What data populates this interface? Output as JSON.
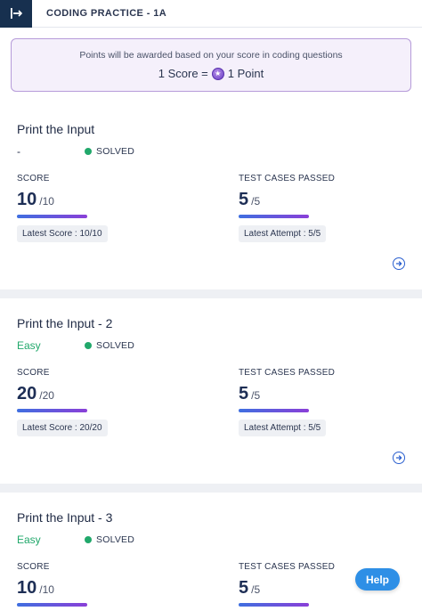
{
  "header": {
    "title": "CODING PRACTICE - 1A"
  },
  "banner": {
    "message": "Points will be awarded based on your score in coding questions",
    "equation_left": "1 Score =",
    "equation_right": "1 Point"
  },
  "questions": [
    {
      "title": "Print the Input",
      "difficulty": "-",
      "difficulty_color": "#1f2a44",
      "status": "SOLVED",
      "score_label": "SCORE",
      "score": "10",
      "score_max": "/10",
      "score_progress": 1.0,
      "latest_score": "Latest Score : 10/10",
      "tests_label": "TEST CASES PASSED",
      "tests": "5",
      "tests_max": "/5",
      "tests_progress": 1.0,
      "latest_attempt": "Latest Attempt : 5/5"
    },
    {
      "title": "Print the Input - 2",
      "difficulty": "Easy",
      "difficulty_color": "#21a86b",
      "status": "SOLVED",
      "score_label": "SCORE",
      "score": "20",
      "score_max": "/20",
      "score_progress": 1.0,
      "latest_score": "Latest Score : 20/20",
      "tests_label": "TEST CASES PASSED",
      "tests": "5",
      "tests_max": "/5",
      "tests_progress": 1.0,
      "latest_attempt": "Latest Attempt : 5/5"
    },
    {
      "title": "Print the Input - 3",
      "difficulty": "Easy",
      "difficulty_color": "#21a86b",
      "status": "SOLVED",
      "score_label": "SCORE",
      "score": "10",
      "score_max": "/10",
      "score_progress": 1.0,
      "tests_label": "TEST CASES PASSED",
      "tests": "5",
      "tests_max": "/5",
      "tests_progress": 1.0
    }
  ],
  "help_button": {
    "label": "Help"
  },
  "colors": {
    "accent": "#2e8fe6",
    "solved": "#21a86b",
    "banner_border": "#b69bd9",
    "header_logo_bg": "#17304f"
  }
}
